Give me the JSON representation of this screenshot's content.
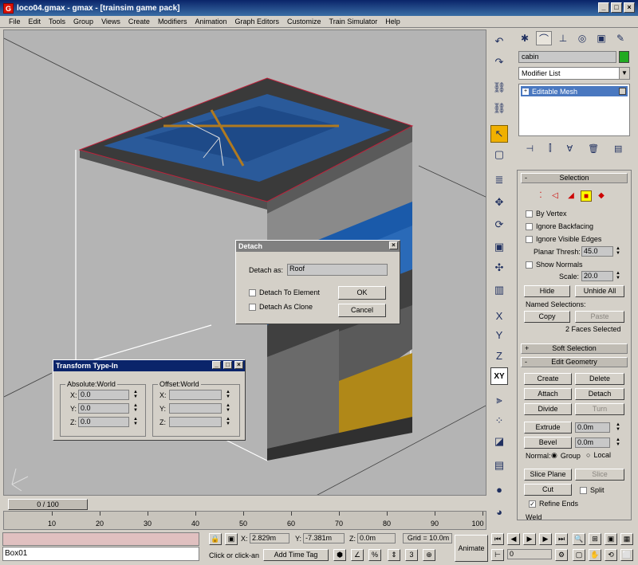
{
  "window": {
    "title": "loco04.gmax - gmax - [trainsim game pack]",
    "app_icon": "G",
    "min": "_",
    "max": "□",
    "close": "×"
  },
  "menu": [
    "File",
    "Edit",
    "Tools",
    "Group",
    "Views",
    "Create",
    "Modifiers",
    "Animation",
    "Graph Editors",
    "Customize",
    "Train Simulator",
    "Help"
  ],
  "detach_dialog": {
    "title": "Detach",
    "close": "×",
    "detach_as_label": "Detach as:",
    "detach_as_value": "Roof",
    "detach_to_element": "Detach To Element",
    "detach_as_clone": "Detach As Clone",
    "ok": "OK",
    "cancel": "Cancel"
  },
  "transform_dialog": {
    "title": "Transform Type-In",
    "absolute_group": "Absolute:World",
    "offset_group": "Offset:World",
    "x_label": "X:",
    "y_label": "Y:",
    "z_label": "Z:",
    "abs_x": "0.0",
    "abs_y": "0.0",
    "abs_z": "0.0",
    "off_x": "",
    "off_y": "",
    "off_z": ""
  },
  "command_panel": {
    "object_name": "cabin",
    "object_color": "#22aa22",
    "modifier_list": "Modifier List",
    "stack_item": "Editable Mesh",
    "selection": {
      "header": "Selection",
      "by_vertex": "By Vertex",
      "ignore_backfacing": "Ignore Backfacing",
      "ignore_visible_edges": "Ignore Visible Edges",
      "planar_thresh_label": "Planar Thresh:",
      "planar_thresh": "45.0",
      "show_normals": "Show Normals",
      "scale_label": "Scale:",
      "scale": "20.0",
      "hide": "Hide",
      "unhide_all": "Unhide All",
      "named_selections": "Named Selections:",
      "copy": "Copy",
      "paste": "Paste",
      "faces_selected": "2 Faces Selected"
    },
    "soft_selection": "Soft Selection",
    "edit_geometry": {
      "header": "Edit Geometry",
      "create": "Create",
      "delete": "Delete",
      "attach": "Attach",
      "detach": "Detach",
      "divide": "Divide",
      "turn": "Turn",
      "extrude": "Extrude",
      "extrude_val": "0.0m",
      "bevel": "Bevel",
      "bevel_val": "0.0m",
      "normal_label": "Normal:",
      "group": "Group",
      "local": "Local",
      "slice_plane": "Slice Plane",
      "slice": "Slice",
      "cut": "Cut",
      "split": "Split",
      "refine_ends": "Refine Ends",
      "weld": "Weld"
    },
    "minus": "-",
    "plus": "+"
  },
  "timeline": {
    "slider": "0 / 100",
    "ticks": [
      "10",
      "20",
      "30",
      "40",
      "50",
      "60",
      "70",
      "80",
      "90",
      "100"
    ]
  },
  "status": {
    "name_value": "Box01",
    "x_label": "X:",
    "x": "2.829m",
    "y_label": "Y:",
    "y": "-7.381m",
    "z_label": "Z:",
    "z": "0.0m",
    "grid": "Grid = 10.0m",
    "prompt": "Click or click-an",
    "add_time_tag": "Add Time Tag",
    "animate": "Animate",
    "frame": "0"
  },
  "vtool_xy": "XY"
}
